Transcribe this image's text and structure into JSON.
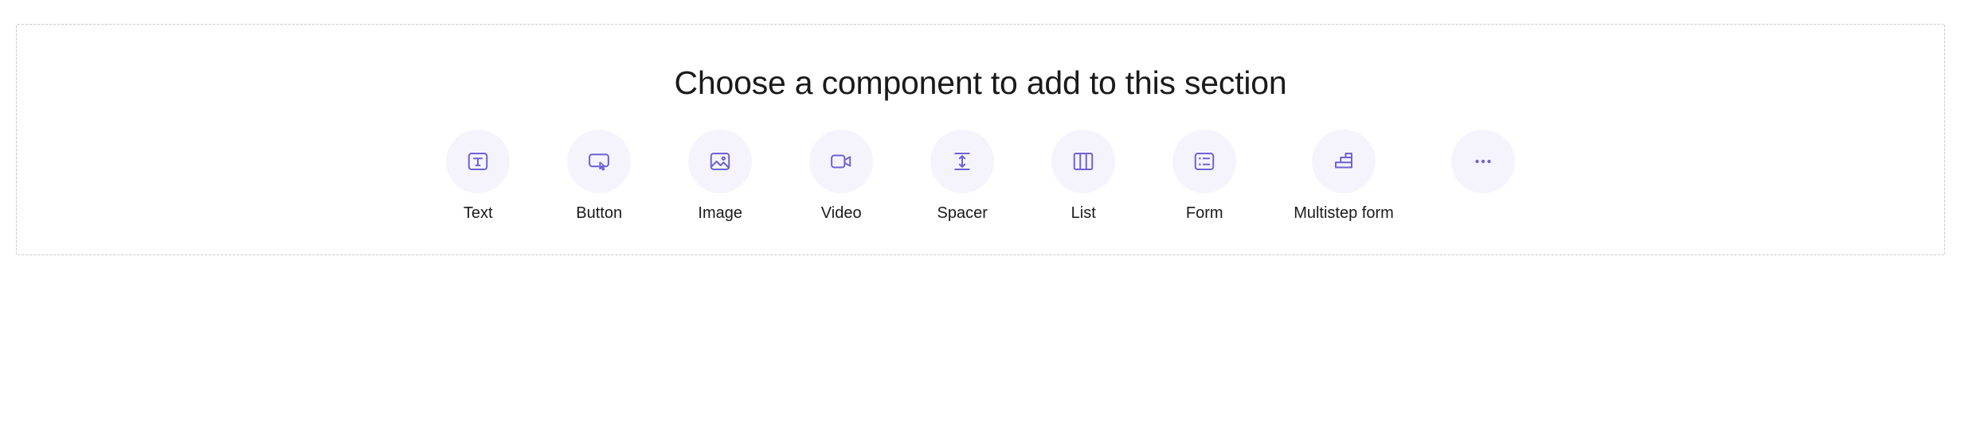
{
  "section": {
    "heading": "Choose a component to add to this section",
    "components": [
      {
        "id": "text",
        "label": "Text",
        "icon": "text-icon"
      },
      {
        "id": "button",
        "label": "Button",
        "icon": "button-icon"
      },
      {
        "id": "image",
        "label": "Image",
        "icon": "image-icon"
      },
      {
        "id": "video",
        "label": "Video",
        "icon": "video-icon"
      },
      {
        "id": "spacer",
        "label": "Spacer",
        "icon": "spacer-icon"
      },
      {
        "id": "list",
        "label": "List",
        "icon": "list-icon"
      },
      {
        "id": "form",
        "label": "Form",
        "icon": "form-icon"
      },
      {
        "id": "multistep-form",
        "label": "Multistep form",
        "icon": "multistep-form-icon"
      },
      {
        "id": "more",
        "label": "",
        "icon": "more-icon"
      }
    ]
  },
  "colors": {
    "icon_stroke": "#6e62d6",
    "icon_bg": "#f5f4fd",
    "border_dash": "#c8c8c8",
    "text": "#1a1a1a"
  }
}
